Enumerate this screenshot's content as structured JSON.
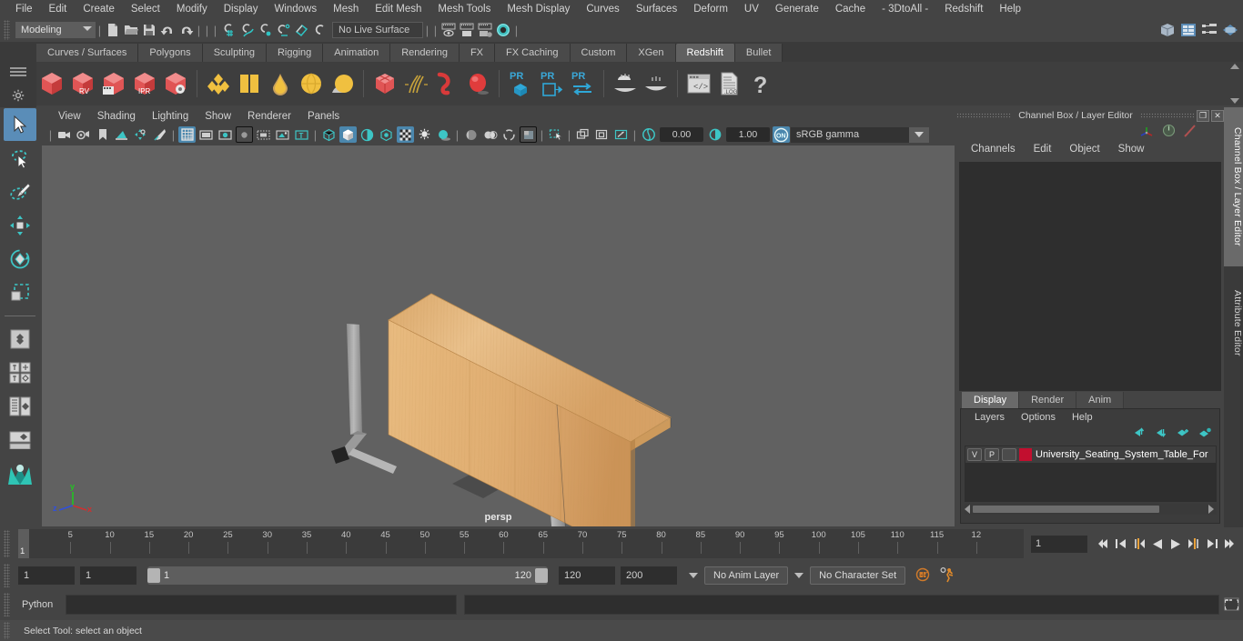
{
  "menubar": {
    "items": [
      "File",
      "Edit",
      "Create",
      "Select",
      "Modify",
      "Display",
      "Windows",
      "Mesh",
      "Edit Mesh",
      "Mesh Tools",
      "Mesh Display",
      "Curves",
      "Surfaces",
      "Deform",
      "UV",
      "Generate",
      "Cache",
      "- 3DtoAll -",
      "Redshift",
      "Help"
    ]
  },
  "status_line": {
    "menu_set": "Modeling",
    "live_surface": "No Live Surface",
    "icons": [
      "new-scene-icon",
      "open-scene-icon",
      "save-scene-icon",
      "undo-icon",
      "redo-icon",
      "snap-to-grid-icon",
      "snap-to-curve-icon",
      "snap-to-point-icon",
      "snap-to-projected-center-icon",
      "snap-to-plane-icon",
      "snap-to-view-plane-icon",
      "select-by-hierarchy-icon",
      "select-by-object-icon",
      "select-by-component-icon",
      "render-view-icon",
      "render-settings-icon",
      "hypershade-icon",
      "outliner-icon",
      "node-editor-icon",
      "attribute-editor-icon"
    ]
  },
  "shelf": {
    "tabs": [
      "Curves / Surfaces",
      "Polygons",
      "Sculpting",
      "Rigging",
      "Animation",
      "Rendering",
      "FX",
      "FX Caching",
      "Custom",
      "XGen",
      "Redshift",
      "Bullet"
    ],
    "active_tab": "Redshift",
    "buttons": [
      "redshift-render-icon",
      "redshift-rv-icon",
      "redshift-sequence-icon",
      "redshift-ipr-icon",
      "redshift-settings-icon",
      "rs-material-icon",
      "rs-material-blender-icon",
      "rs-incandescent-icon",
      "rs-sss-icon",
      "rs-skin-icon",
      "rs-volume-icon",
      "rs-hair-icon",
      "rs-curve-icon",
      "rs-sprite-icon",
      "rs-proxy-icon",
      "rs-proxy-export-icon",
      "rs-proxy-params-icon",
      "rs-dome-light-icon",
      "rs-ies-light-icon",
      "rs-log-console-icon",
      "rs-log-file-icon",
      "rs-help-icon"
    ]
  },
  "toolbox": {
    "tools": [
      "select-tool",
      "lasso-select-tool",
      "paint-select-tool",
      "move-tool",
      "rotate-tool",
      "scale-tool",
      "last-tool-used",
      "four-view-layout",
      "persp-outliner-layout",
      "hypershade-layout",
      "single-perspective-layout",
      "maya-logo-icon"
    ],
    "active": "select-tool"
  },
  "viewport": {
    "menus": [
      "View",
      "Shading",
      "Lighting",
      "Show",
      "Renderer",
      "Panels"
    ],
    "camera_label": "persp",
    "gamma": "sRGB gamma",
    "exposure": "0.00",
    "contrast": "1.00",
    "axis": {
      "x": "x",
      "y": "y",
      "z": "z"
    },
    "toolbar_icons": [
      "select-camera-icon",
      "camera-attributes-icon",
      "bookmark-icon",
      "image-plane-icon",
      "two-d-pan-zoom-icon",
      "grease-pencil-icon",
      "grid-toggle-icon",
      "film-gate-icon",
      "resolution-gate-icon",
      "gate-mask-icon",
      "film-origin-icon",
      "xray-icon",
      "hud-text-icon",
      "wireframe-icon",
      "smooth-shade-icon",
      "shaded-wireframe-icon",
      "textured-icon",
      "use-all-lights-icon",
      "shadows-icon",
      "ao-icon",
      "motion-blur-icon",
      "multisample-icon",
      "depth-of-field-icon",
      "isolate-select-icon",
      "xray-joints-icon",
      "xray-active-icon",
      "exposure-icon",
      "gamma-icon",
      "color-management-icon"
    ]
  },
  "right_panel": {
    "title": "Channel Box / Layer Editor",
    "window_buttons": [
      "restore-icon",
      "close-icon"
    ],
    "menus": [
      "Channels",
      "Edit",
      "Object",
      "Show"
    ],
    "side_tabs": [
      "Channel Box / Layer Editor",
      "Attribute Editor"
    ],
    "active_side_tab": "Channel Box / Layer Editor"
  },
  "layer_editor": {
    "tabs": [
      "Display",
      "Render",
      "Anim"
    ],
    "active_tab": "Display",
    "menus": [
      "Layers",
      "Options",
      "Help"
    ],
    "toolbar_icons": [
      "move-layer-up-icon",
      "move-layer-down-icon",
      "new-layer-icon",
      "new-layer-from-selected-icon"
    ],
    "layers": [
      {
        "visibility": "V",
        "playback": "P",
        "shading": "",
        "color": "#c20f2f",
        "name": "University_Seating_System_Table_For"
      }
    ]
  },
  "timeline": {
    "tick_labels": [
      "5",
      "10",
      "15",
      "20",
      "25",
      "30",
      "35",
      "40",
      "45",
      "50",
      "55",
      "60",
      "65",
      "70",
      "75",
      "80",
      "85",
      "90",
      "95",
      "100",
      "105",
      "110",
      "115",
      "12"
    ],
    "current_frame_marker": "1",
    "current_frame_field": "1",
    "playback_buttons": [
      "go-to-start-icon",
      "step-back-keyframe-icon",
      "step-back-frame-icon",
      "play-backwards-icon",
      "play-forwards-icon",
      "step-forward-frame-icon",
      "step-forward-keyframe-icon",
      "go-to-end-icon"
    ]
  },
  "range_slider": {
    "anim_start": "1",
    "playback_start": "1",
    "range_left_label": "1",
    "range_right_label": "120",
    "playback_end": "120",
    "anim_end": "200",
    "anim_layer": "No Anim Layer",
    "character_set": "No Character Set",
    "icons": [
      "auto-keyframe-icon",
      "animation-preferences-icon"
    ]
  },
  "command_line": {
    "language_label": "Python",
    "input_value": "",
    "input_placeholder": "",
    "script_editor_icon": "script-editor-icon"
  },
  "help_line": {
    "text": "Select Tool: select an object"
  }
}
